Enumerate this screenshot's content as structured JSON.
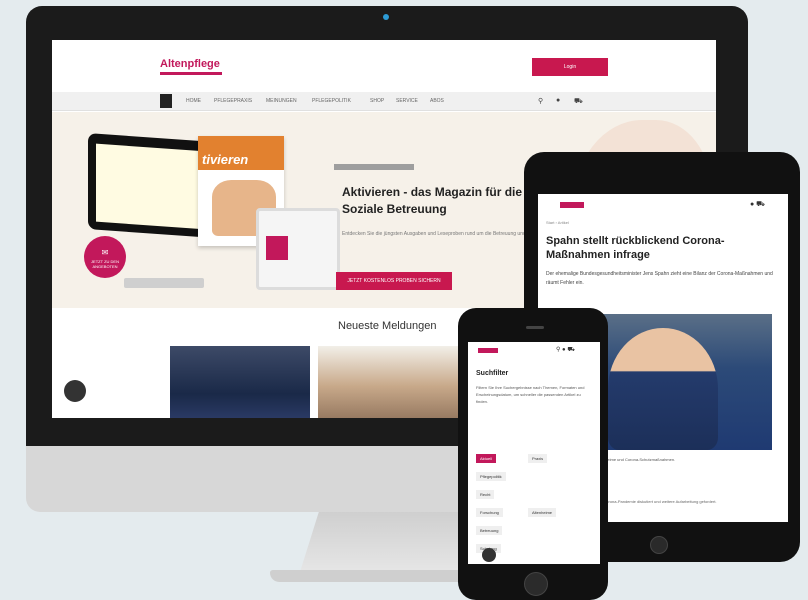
{
  "desktop": {
    "logo": "Altenpflege",
    "login_label": "Login",
    "nav": [
      "HOME",
      "PFLEGEPRAXIS",
      "MEINUNGEN",
      "PFLEGEPOLITIK",
      "SHOP",
      "SERVICE",
      "ABOS"
    ],
    "icons": {
      "search": "search-icon",
      "user": "user-icon",
      "cart": "cart-icon"
    },
    "hero": {
      "title": "Aktivieren - das Magazin für die Soziale Betreuung",
      "text": "Entdecken Sie die jüngsten Ausgaben und Leseproben rund um die Betreuung und Aktivierung",
      "cta": "JETZT KOSTENLOS PROBEN SICHERN",
      "magazine_title": "tivieren",
      "badge": "JETZT ZU DEN ANGEBOTEN"
    },
    "news_heading": "Neueste Meldungen"
  },
  "tablet": {
    "breadcrumb": "Start › Artikel",
    "title": "Spahn stellt rückblickend Corona-Maßnahmen infrage",
    "text": "Der ehemalige Bundesgesundheitsminister Jens Spahn zieht eine Bilanz der Corona-Maßnahmen und räumt Fehler ein.",
    "caption": "Jens Spahn im Interview über Pflegeheime und Corona-Schutzmaßnahmen.",
    "footer": "Der Bundestag hat die Berichte zur Corona-Pandemie diskutiert und weitere Aufarbeitung gefordert."
  },
  "phone": {
    "title": "Suchfilter",
    "text": "Filtern Sie Ihre Suchergebnisse nach Themen, Formaten und Erscheinungsdatum, um schneller die passenden Artikel zu finden.",
    "tags": [
      "Aktuell",
      "Praxis",
      "Pflegepolitik",
      "Recht",
      "Forschung",
      "Altenheime",
      "Betreuung",
      "Schulung"
    ]
  },
  "colors": {
    "accent": "#c2185b",
    "device": "#111111",
    "background": "#e4ebee"
  }
}
